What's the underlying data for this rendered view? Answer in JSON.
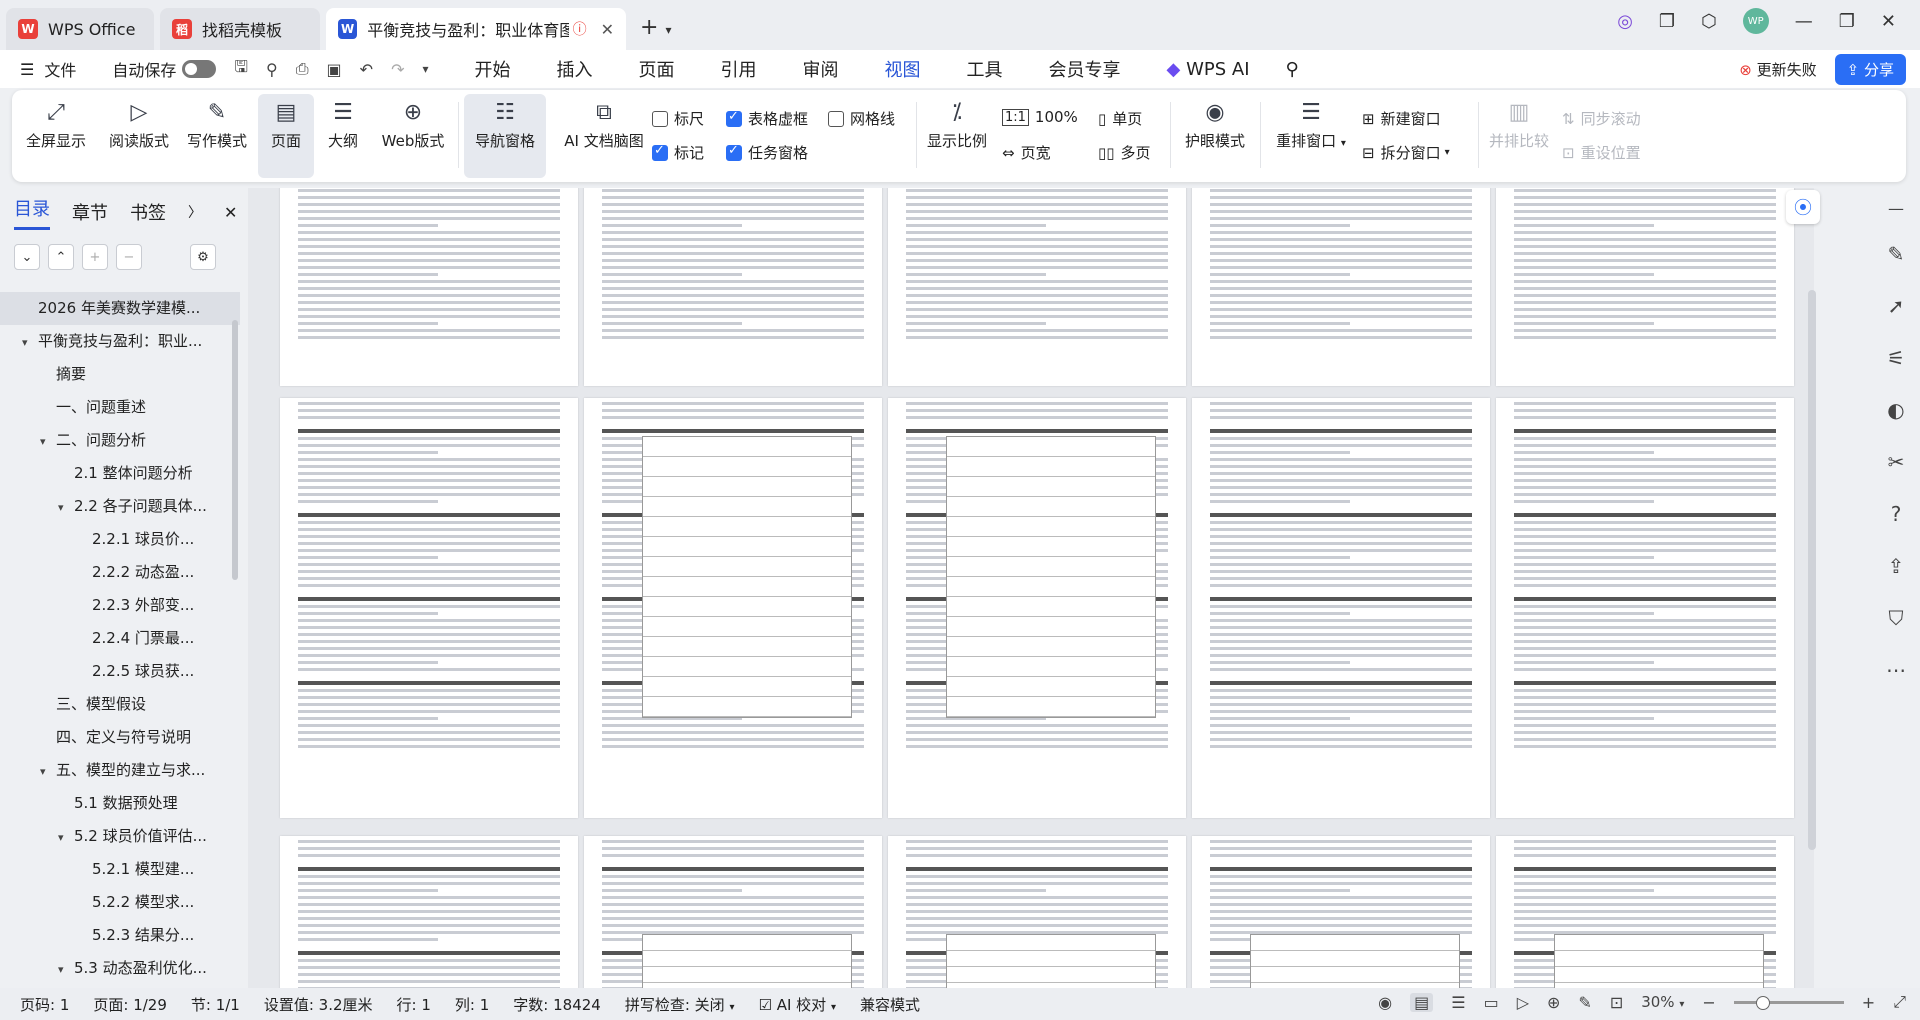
{
  "titlebar": {
    "tabs": [
      {
        "label": "WPS Office",
        "logo": "W",
        "color": "#e9403a"
      },
      {
        "label": "找稻壳模板",
        "logo": "稻",
        "color": "#e9403a"
      },
      {
        "label": "平衡竞技与盈利：职业体育图",
        "logo": "W",
        "color": "#2a56d6"
      }
    ],
    "avatar_text": "WP"
  },
  "menubar": {
    "file_label": "文件",
    "autosave_label": "自动保存",
    "tabs": [
      "开始",
      "插入",
      "页面",
      "引用",
      "审阅",
      "视图",
      "工具",
      "会员专享"
    ],
    "active_tab": "视图",
    "wps_ai_label": "WPS AI",
    "update_failed_label": "更新失败",
    "share_label": "分享"
  },
  "ribbon": {
    "big_buttons": {
      "fullscreen": "全屏显示",
      "reading": "阅读版式",
      "writing": "写作模式",
      "page": "页面",
      "outline": "大纲",
      "web": "Web版式",
      "nav_pane": "导航窗格",
      "ai_mindmap": "AI 文档脑图",
      "zoom_ratio": "显示比例",
      "eye_mode": "护眼模式",
      "rearrange": "重排窗口",
      "split_window": "拆分窗口",
      "side_compare": "并排比较"
    },
    "checkboxes": {
      "ruler": "标尺",
      "table_lines": "表格虚框",
      "gridlines": "网格线",
      "marks": "标记",
      "task_pane": "任务窗格"
    },
    "zoom_100": "100%",
    "page_width": "页宽",
    "single_page": "单页",
    "multi_page": "多页",
    "new_window": "新建窗口",
    "sync_scroll": "同步滚动",
    "reset_position": "重设位置"
  },
  "leftpanel": {
    "tabs": [
      "目录",
      "章节",
      "书签"
    ],
    "toc": [
      {
        "label": "2026 年美赛数学建模...",
        "level": 0,
        "arrow": ""
      },
      {
        "label": "平衡竞技与盈利：职业...",
        "level": 0,
        "arrow": "▾"
      },
      {
        "label": "摘要",
        "level": 1,
        "arrow": ""
      },
      {
        "label": "一、问题重述",
        "level": 1,
        "arrow": ""
      },
      {
        "label": "二、问题分析",
        "level": 1,
        "arrow": "▾"
      },
      {
        "label": "2.1 整体问题分析",
        "level": 2,
        "arrow": ""
      },
      {
        "label": "2.2 各子问题具体...",
        "level": 2,
        "arrow": "▾"
      },
      {
        "label": "2.2.1 球员价...",
        "level": 3,
        "arrow": ""
      },
      {
        "label": "2.2.2 动态盈...",
        "level": 3,
        "arrow": ""
      },
      {
        "label": "2.2.3 外部变...",
        "level": 3,
        "arrow": ""
      },
      {
        "label": "2.2.4 门票最...",
        "level": 3,
        "arrow": ""
      },
      {
        "label": "2.2.5 球员获...",
        "level": 3,
        "arrow": ""
      },
      {
        "label": "三、模型假设",
        "level": 1,
        "arrow": ""
      },
      {
        "label": "四、定义与符号说明",
        "level": 1,
        "arrow": ""
      },
      {
        "label": "五、模型的建立与求...",
        "level": 1,
        "arrow": "▾"
      },
      {
        "label": "5.1 数据预处理",
        "level": 2,
        "arrow": ""
      },
      {
        "label": "5.2 球员价值评估...",
        "level": 2,
        "arrow": "▾"
      },
      {
        "label": "5.2.1 模型建...",
        "level": 3,
        "arrow": ""
      },
      {
        "label": "5.2.2 模型求...",
        "level": 3,
        "arrow": ""
      },
      {
        "label": "5.2.3 结果分...",
        "level": 3,
        "arrow": ""
      },
      {
        "label": "5.3 动态盈利优化...",
        "level": 2,
        "arrow": "▾"
      }
    ]
  },
  "statusbar": {
    "page_code": "页码: 1",
    "page": "页面: 1/29",
    "section": "节: 1/1",
    "setting": "设置值: 3.2厘米",
    "line": "行: 1",
    "column": "列: 1",
    "word_count": "字数: 18424",
    "spellcheck": "拼写检查: 关闭",
    "ai_proof": "AI 校对",
    "compat_mode": "兼容模式",
    "zoom": "30%"
  }
}
